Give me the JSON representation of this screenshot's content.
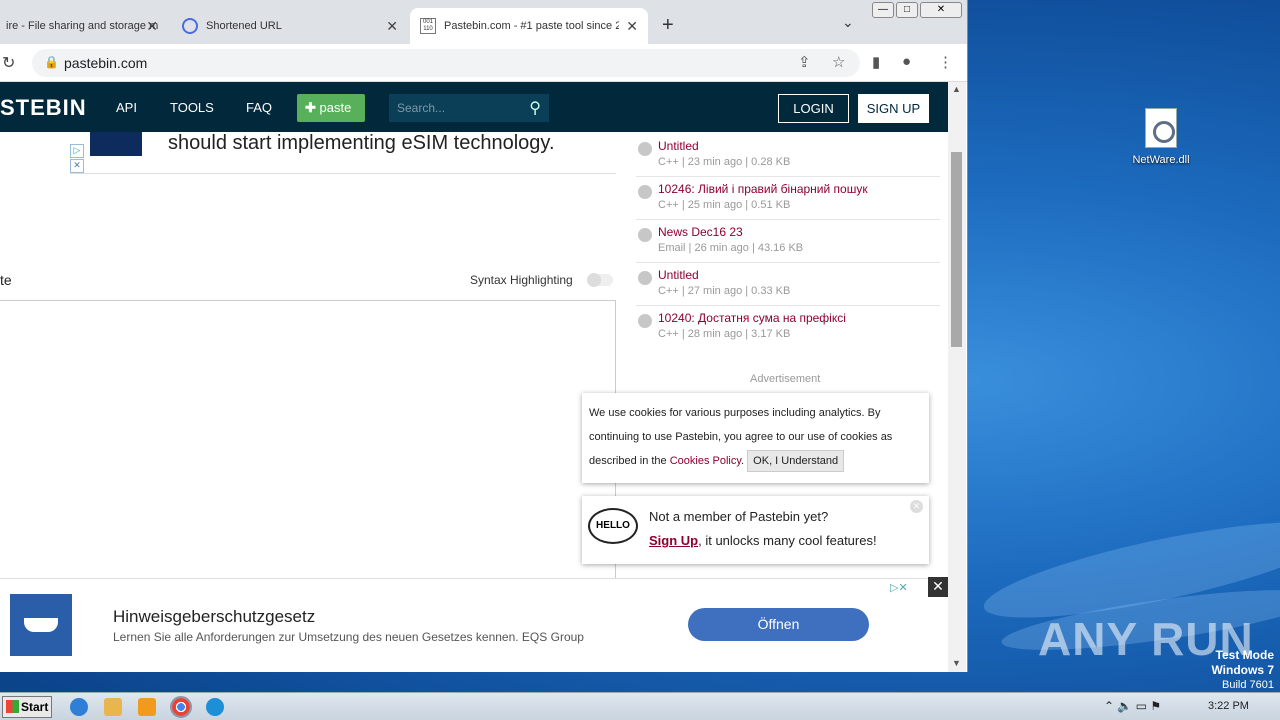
{
  "tabs": [
    {
      "title": "ire - File sharing and storage m"
    },
    {
      "title": "Shortened URL"
    },
    {
      "title": "Pastebin.com - #1 paste tool since 2"
    }
  ],
  "address": {
    "url": "pastebin.com"
  },
  "nav": {
    "logo": "STEBIN",
    "api": "API",
    "tools": "TOOLS",
    "faq": "FAQ",
    "paste": "paste",
    "search_placeholder": "Search...",
    "login": "LOGIN",
    "signup": "SIGN UP"
  },
  "ad_top": {
    "text": "should start implementing eSIM technology."
  },
  "editor": {
    "label": "te",
    "syntax": "Syntax Highlighting"
  },
  "recent_pastes": [
    {
      "title": "Untitled",
      "meta": "C++ | 23 min ago | 0.28 KB"
    },
    {
      "title": "10246: Лівий і правий бінарний пошук",
      "meta": "C++ | 25 min ago | 0.51 KB"
    },
    {
      "title": "News Dec16 23",
      "meta": "Email | 26 min ago | 43.16 KB"
    },
    {
      "title": "Untitled",
      "meta": "C++ | 27 min ago | 0.33 KB"
    },
    {
      "title": "10240: Достатня сума на префіксі",
      "meta": "C++ | 28 min ago | 3.17 KB"
    }
  ],
  "advertisement_label": "Advertisement",
  "cookie": {
    "text1": "We use cookies for various purposes including analytics. By continuing to use Pastebin, you agree to our use of cookies as described in the ",
    "link": "Cookies Policy",
    "text2": ".",
    "ok": "OK, I Understand"
  },
  "member": {
    "hello": "HELLO",
    "line1": "Not a member of Pastebin yet?",
    "signup": "Sign Up",
    "line2": ", it unlocks many cool features!"
  },
  "bottom_ad": {
    "title": "Hinweisgeberschutzgesetz",
    "subtitle": "Lernen Sie alle Anforderungen zur Umsetzung des neuen Gesetzes kennen. EQS Group",
    "button": "Öffnen"
  },
  "desktop": {
    "file": "NetWare.dll",
    "watermark": "ANY RUN",
    "test_mode": "Test Mode",
    "os": "Windows 7",
    "build": "Build 7601"
  },
  "taskbar": {
    "start": "Start",
    "time": "3:22 PM"
  }
}
